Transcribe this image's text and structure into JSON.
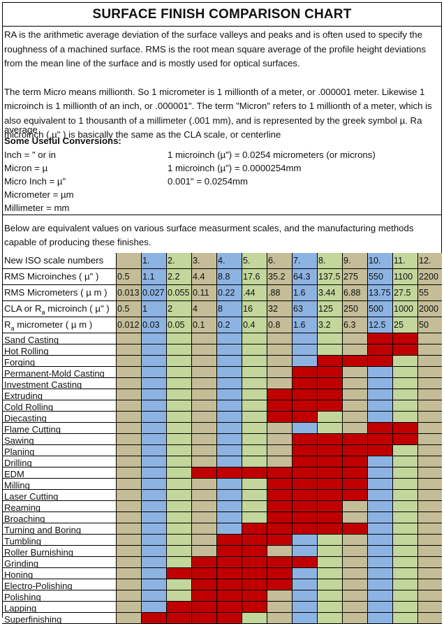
{
  "title": "SURFACE FINISH COMPARISON CHART",
  "intro": {
    "paragraph1": "RA is the arithmetic average deviation of the surface valleys and peaks and is often used to specify the roughness of a machined surface.  RMS is the root mean square average of the profile height deviations from the mean line of the surface and is mostly used for optical surfaces.",
    "paragraph2": "The term Micro means millionth.  So 1 micrometer is 1 millionth of a meter, or .000001 meter. Likewise 1 microinch is 1 millionth of an inch, or .000001\".  The term \"Micron\" refers to 1 millionth of a meter, which is also equivalent to 1 thousanth of a millimeter (.001 mm), and is represented by the greek symbol µ.  Ra microinch ( µ\" ) is basically the same as the CLA scale, or centerline",
    "cutoff_text": "average"
  },
  "conversions": {
    "heading": "Some Useful Conversions:",
    "left": [
      "Inch = \" or in",
      "Micron = µ",
      "Micro Inch = µ\"",
      "Micrometer = µm",
      "Millimeter = mm"
    ],
    "right": [
      "1 microinch (µ\") = 0.0254 micrometers (or microns)",
      "1 microinch (µ\") = 0.0000254mm",
      "0.001\" = 0.0254mm"
    ]
  },
  "below_text": "Below are equivalent values on various surface measurment scales, and the manufacturing methods capable of producing these finishes.",
  "colors": {
    "tan": "#c4bd97",
    "blue": "#8db3e2",
    "green": "#c3d69b",
    "red": "#c00000"
  },
  "chart_data": {
    "type": "table",
    "title": "SURFACE FINISH COMPARISON CHART",
    "column_color_pattern": [
      "tan",
      "blue",
      "green",
      "tan",
      "blue",
      "green",
      "tan",
      "blue",
      "green",
      "tan",
      "blue",
      "green",
      "tan"
    ],
    "scale_rows": [
      {
        "label": "New ISO scale numbers",
        "values": [
          "",
          "1.",
          "2.",
          "3.",
          "4.",
          "5.",
          "6.",
          "7.",
          "8.",
          "9.",
          "10.",
          "11.",
          "12."
        ]
      },
      {
        "label": "RMS Microinches ( µ\" )",
        "values": [
          "0.5",
          "1.1",
          "2.2",
          "4.4",
          "8.8",
          "17.6",
          "35.2",
          "64.3",
          "137.5",
          "275",
          "550",
          "1100",
          "2200"
        ]
      },
      {
        "label": "RMS Micrometers ( µ m )",
        "values": [
          "0.013",
          "0.027",
          "0.055",
          "0.11",
          "0.22",
          ".44",
          ".88",
          "1.6",
          "3.44",
          "6.88",
          "13.75",
          "27.5",
          "55"
        ]
      },
      {
        "label_pre": "CLA or R",
        "label_sub": "a",
        "label_post": " microinch ( µ\" )",
        "values": [
          "0.5",
          "1",
          "2",
          "4",
          "8",
          "16",
          "32",
          "63",
          "125",
          "250",
          "500",
          "1000",
          "2000"
        ]
      },
      {
        "label_pre": "R",
        "label_sub": "a",
        "label_post": " micrometer  ( µ m )",
        "values": [
          "0.012",
          "0.03",
          "0.05",
          "0.1",
          "0.2",
          "0.4",
          "0.8",
          "1.6",
          "3.2",
          "6.3",
          "12.5",
          "25",
          "50"
        ]
      }
    ],
    "processes": [
      {
        "name": "Sand Casting",
        "range_columns": [
          10,
          11
        ]
      },
      {
        "name": "Hot Rolling",
        "range_columns": [
          10,
          11
        ]
      },
      {
        "name": "Forging",
        "range_columns": [
          8,
          9,
          10
        ]
      },
      {
        "name": "Permanent-Mold Casting",
        "range_columns": [
          7,
          8
        ]
      },
      {
        "name": "Investment Casting",
        "range_columns": [
          7,
          8
        ]
      },
      {
        "name": "Extruding",
        "range_columns": [
          6,
          7,
          8
        ]
      },
      {
        "name": "Cold Rolling",
        "range_columns": [
          6,
          7,
          8
        ]
      },
      {
        "name": "Diecasting",
        "range_columns": [
          6,
          7
        ]
      },
      {
        "name": "Flame Cutting",
        "range_columns": [
          10,
          11
        ]
      },
      {
        "name": "Sawing",
        "range_columns": [
          7,
          8,
          9,
          10,
          11
        ]
      },
      {
        "name": "Planing",
        "range_columns": [
          7,
          8,
          9,
          10
        ]
      },
      {
        "name": "Drilling",
        "range_columns": [
          7,
          8,
          9
        ]
      },
      {
        "name": "EDM",
        "range_columns": [
          3,
          4,
          5,
          6,
          7,
          8,
          9
        ]
      },
      {
        "name": "Milling",
        "range_columns": [
          6,
          7,
          8,
          9
        ]
      },
      {
        "name": "Laser Cutting",
        "range_columns": [
          6,
          7,
          8,
          9
        ]
      },
      {
        "name": "Reaming",
        "range_columns": [
          6,
          7,
          8
        ]
      },
      {
        "name": "Broaching",
        "range_columns": [
          6,
          7,
          8
        ]
      },
      {
        "name": "Turning and Boring",
        "range_columns": [
          5,
          6,
          7,
          8,
          9
        ]
      },
      {
        "name": "Tumbling",
        "range_columns": [
          4,
          5,
          6
        ]
      },
      {
        "name": "Roller Burnishing",
        "range_columns": [
          4,
          5
        ]
      },
      {
        "name": "Grinding",
        "range_columns": [
          3,
          4,
          5,
          6,
          7
        ]
      },
      {
        "name": "Honing",
        "range_columns": [
          2,
          3,
          4,
          5,
          6
        ]
      },
      {
        "name": "Electro-Polishing",
        "range_columns": [
          3,
          4,
          5,
          6
        ]
      },
      {
        "name": "Polishing",
        "range_columns": [
          3,
          4,
          5
        ]
      },
      {
        "name": "Lapping",
        "range_columns": [
          2,
          3,
          4,
          5
        ]
      },
      {
        "name": "Superfinishing",
        "range_columns": [
          1,
          2,
          3,
          4
        ]
      }
    ]
  }
}
